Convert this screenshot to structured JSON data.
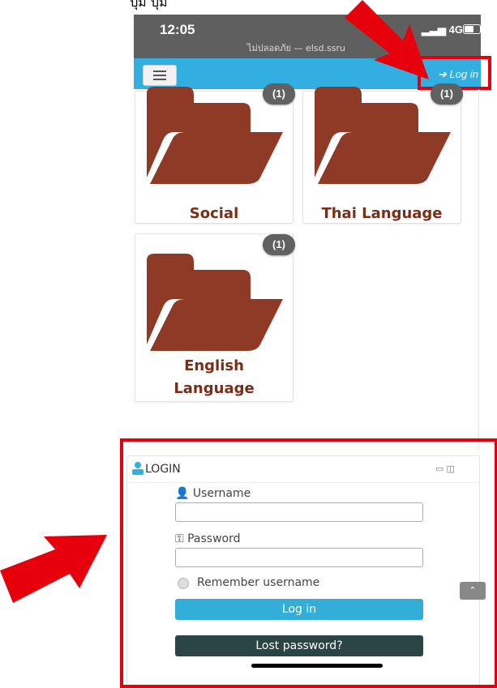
{
  "top_text": "ปุ่ม              ปุ่ม",
  "status": {
    "time": "12:05",
    "network": "4G",
    "url": "ไม่ปลอดภัย — elsd.ssru"
  },
  "appbar": {
    "login_link": "Log in"
  },
  "folders": [
    {
      "name": "Social",
      "count": "(1)"
    },
    {
      "name": "Thai Language",
      "count": "(1)"
    },
    {
      "name": "English Language",
      "name_line1": "English",
      "name_line2": "Language",
      "count": "(1)"
    }
  ],
  "login_block": {
    "title": "LOGIN",
    "username_label": "Username",
    "username_value": "",
    "password_label": "Password",
    "password_value": "",
    "remember_label": "Remember username",
    "login_button": "Log in",
    "lost_password_button": "Lost password?"
  },
  "colors": {
    "highlight": "#e5000b",
    "folder": "#8e3a26",
    "label": "#7a2d17",
    "accent": "#32aee0",
    "dark_button": "#2b4547"
  },
  "icons": [
    "hamburger-icon",
    "sign-in-icon",
    "folder-icon",
    "user-icon",
    "key-icon",
    "radio-icon",
    "chevron-up-icon",
    "arrow-icon"
  ]
}
